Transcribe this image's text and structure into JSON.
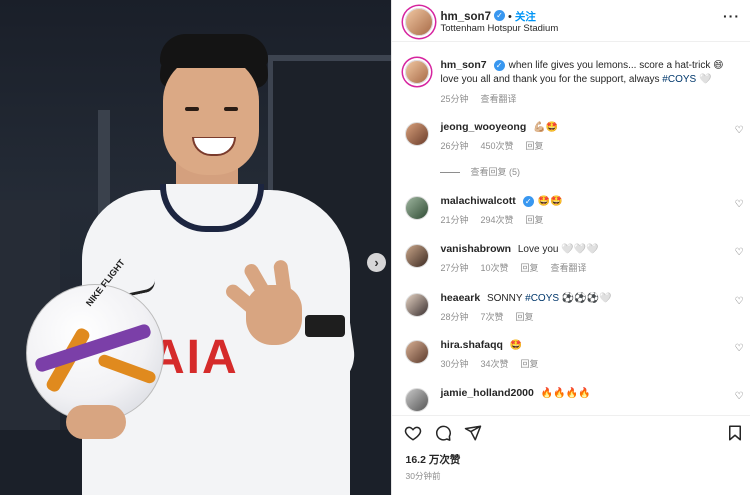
{
  "post": {
    "username": "hm_son7",
    "follow_label": "关注",
    "separator": "•",
    "location": "Tottenham Hotspur Stadium",
    "more_label": "···",
    "next_label": "›",
    "photo": {
      "shirt_sponsor": "AIA",
      "ball_text": "NIKE FLIGHT"
    }
  },
  "caption": {
    "username": "hm_son7",
    "text_1": "when life gives you lemons... score a hat-trick",
    "emoji_1": "😄",
    "text_2": "love you all and thank you for the support, always",
    "hashtag": "#COYS",
    "emoji_2": "🤍",
    "time": "25分钟",
    "translate": "查看翻译"
  },
  "comments": [
    {
      "username": "jeong_wooyeong",
      "verified": false,
      "text": "💪🏼🤩",
      "time": "26分钟",
      "likes": "450次赞",
      "reply": "回复",
      "view_replies": "查看回复 (5)"
    },
    {
      "username": "malachiwalcott",
      "verified": true,
      "text": "🤩🤩",
      "time": "21分钟",
      "likes": "294次赞",
      "reply": "回复"
    },
    {
      "username": "vanishabrown",
      "verified": false,
      "text": "Love you 🤍🤍🤍",
      "time": "27分钟",
      "likes": "10次赞",
      "reply": "回复",
      "translate": "查看翻译"
    },
    {
      "username": "heaeark",
      "verified": false,
      "text_before": "SONNY",
      "hashtag": "#COYS",
      "text_after": "⚽⚽⚽🤍",
      "time": "28分钟",
      "likes": "7次赞",
      "reply": "回复"
    },
    {
      "username": "hira.shafaqq",
      "verified": false,
      "text": "🤩",
      "time": "30分钟",
      "likes": "34次赞",
      "reply": "回复"
    },
    {
      "username": "jamie_holland2000",
      "verified": false,
      "text": "🔥🔥🔥🔥"
    }
  ],
  "footer": {
    "likes": "16.2 万次赞",
    "posted": "30分钟前"
  },
  "icons": {
    "like": "heart-icon",
    "comment": "comment-icon",
    "share": "share-icon",
    "save": "bookmark-icon",
    "comment_like": "heart-icon"
  },
  "colors": {
    "link": "#0095f6",
    "hashtag": "#00376b",
    "verified": "#3897f0",
    "meta": "#8e8e8e"
  }
}
